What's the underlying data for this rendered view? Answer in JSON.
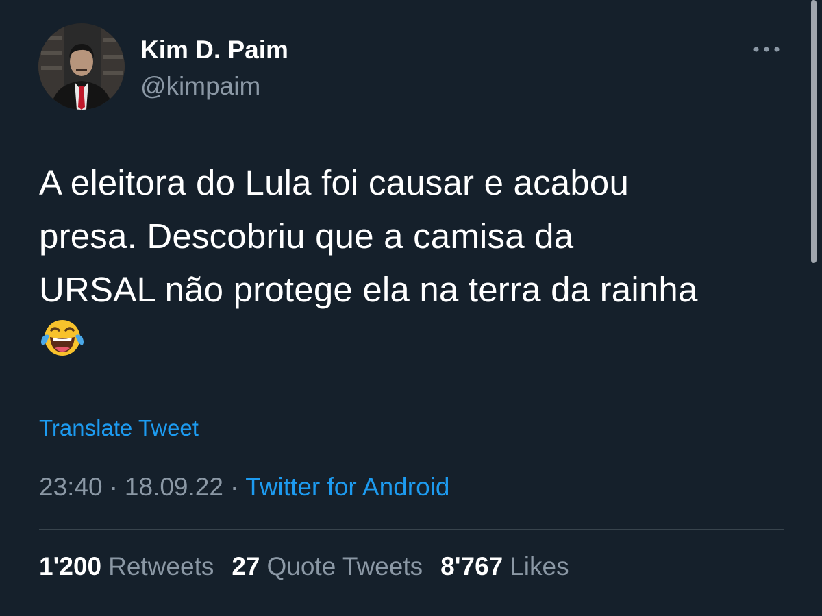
{
  "author": {
    "display_name": "Kim D. Paim",
    "handle": "@kimpaim",
    "avatar_icon": "profile-photo"
  },
  "more_icon": "more-horizontal-icon",
  "tweet": {
    "text": "A eleitora do Lula foi causar e acabou\npresa. Descobriu que a camisa da\nURSAL não protege ela na terra da rainha",
    "emoji": "face-with-tears-of-joy-emoji",
    "translate_label": "Translate Tweet",
    "time": "23:40",
    "date": "18.09.22",
    "separator": "·",
    "source": "Twitter for Android"
  },
  "stats": {
    "retweets_count": "1'200",
    "retweets_label": "Retweets",
    "quotes_count": "27",
    "quotes_label": "Quote Tweets",
    "likes_count": "8'767",
    "likes_label": "Likes"
  },
  "colors": {
    "background": "#15202b",
    "link": "#1d9bf0",
    "secondary_text": "#8b98a5",
    "divider": "#38444d"
  }
}
